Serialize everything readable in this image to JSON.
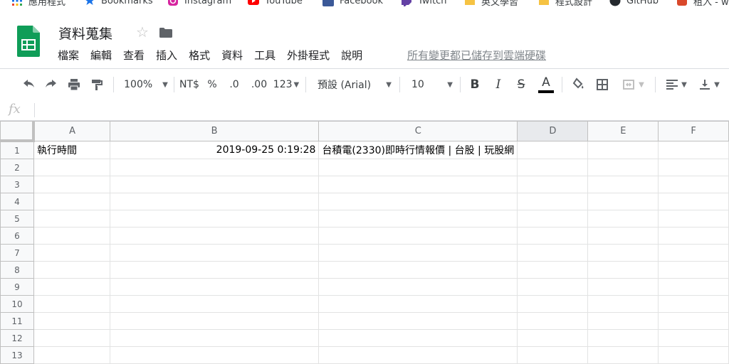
{
  "bookmarks": [
    {
      "label": "應用程式",
      "icon": "apps-grid-icon"
    },
    {
      "label": "Bookmarks",
      "icon": "star-icon"
    },
    {
      "label": "Instagram",
      "icon": "instagram-icon"
    },
    {
      "label": "YouTube",
      "icon": "youtube-icon"
    },
    {
      "label": "Facebook",
      "icon": "facebook-icon"
    },
    {
      "label": "Twitch",
      "icon": "twitch-icon"
    },
    {
      "label": "英文學習",
      "icon": "folder-icon"
    },
    {
      "label": "程式設計",
      "icon": "folder-icon"
    },
    {
      "label": "GitHub",
      "icon": "github-icon"
    },
    {
      "label": "租入 - w",
      "icon": "favicon-icon"
    }
  ],
  "header": {
    "title": "資料蒐集",
    "menus": [
      "檔案",
      "編輯",
      "查看",
      "插入",
      "格式",
      "資料",
      "工具",
      "外掛程式",
      "說明"
    ],
    "save_status": "所有變更都已儲存到雲端硬碟"
  },
  "toolbar": {
    "zoom": "100%",
    "currency": "NT$",
    "percent": "%",
    "decimal_decrease": ".0",
    "decimal_increase": ".00",
    "more_formats": "123",
    "font_family": "預設 (Arial)",
    "font_size": "10",
    "bold": "B",
    "italic": "I",
    "strikethrough": "S",
    "text_color": "A",
    "text_color_bar": "#000000"
  },
  "formula_bar": {
    "fx": "fx",
    "value": ""
  },
  "columns": [
    "A",
    "B",
    "C",
    "D",
    "E",
    "F"
  ],
  "rows": [
    {
      "num": "1",
      "cells": [
        "執行時間",
        "2019-09-25 0:19:28",
        "台積電(2330)即時行情報價 | 台股 | 玩股網",
        "",
        "",
        ""
      ]
    },
    {
      "num": "2",
      "cells": [
        "",
        "",
        "",
        "",
        "",
        ""
      ]
    },
    {
      "num": "3",
      "cells": [
        "",
        "",
        "",
        "",
        "",
        ""
      ]
    },
    {
      "num": "4",
      "cells": [
        "",
        "",
        "",
        "",
        "",
        ""
      ]
    },
    {
      "num": "5",
      "cells": [
        "",
        "",
        "",
        "",
        "",
        ""
      ]
    },
    {
      "num": "6",
      "cells": [
        "",
        "",
        "",
        "",
        "",
        ""
      ]
    },
    {
      "num": "7",
      "cells": [
        "",
        "",
        "",
        "",
        "",
        ""
      ]
    },
    {
      "num": "8",
      "cells": [
        "",
        "",
        "",
        "",
        "",
        ""
      ]
    },
    {
      "num": "9",
      "cells": [
        "",
        "",
        "",
        "",
        "",
        ""
      ]
    },
    {
      "num": "10",
      "cells": [
        "",
        "",
        "",
        "",
        "",
        ""
      ]
    },
    {
      "num": "11",
      "cells": [
        "",
        "",
        "",
        "",
        "",
        ""
      ]
    },
    {
      "num": "12",
      "cells": [
        "",
        "",
        "",
        "",
        "",
        ""
      ]
    },
    {
      "num": "13",
      "cells": [
        "",
        "",
        "",
        "",
        "",
        ""
      ]
    }
  ],
  "colors": {
    "sheets_green": "#0f9d58",
    "selected_col_header": "#e8eaed"
  }
}
